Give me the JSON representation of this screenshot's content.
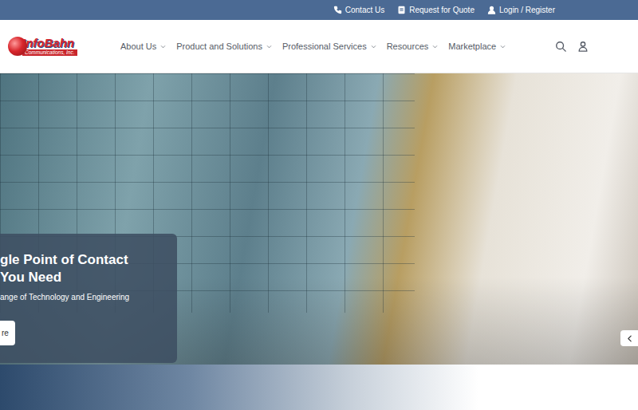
{
  "topbar": {
    "links": [
      "Contact Us",
      "Request for Quote",
      "Login / Register"
    ]
  },
  "logo": {
    "name": "InfoBahn",
    "tagline": "Communications, Inc."
  },
  "nav": {
    "items": [
      "About Us",
      "Product and Solutions",
      "Professional Services",
      "Resources",
      "Marketplace"
    ]
  },
  "hero": {
    "title_lines": [
      "gle Point of Contact",
      "You Need"
    ],
    "subtitle": "ange of Technology and Engineering",
    "button": "re"
  }
}
